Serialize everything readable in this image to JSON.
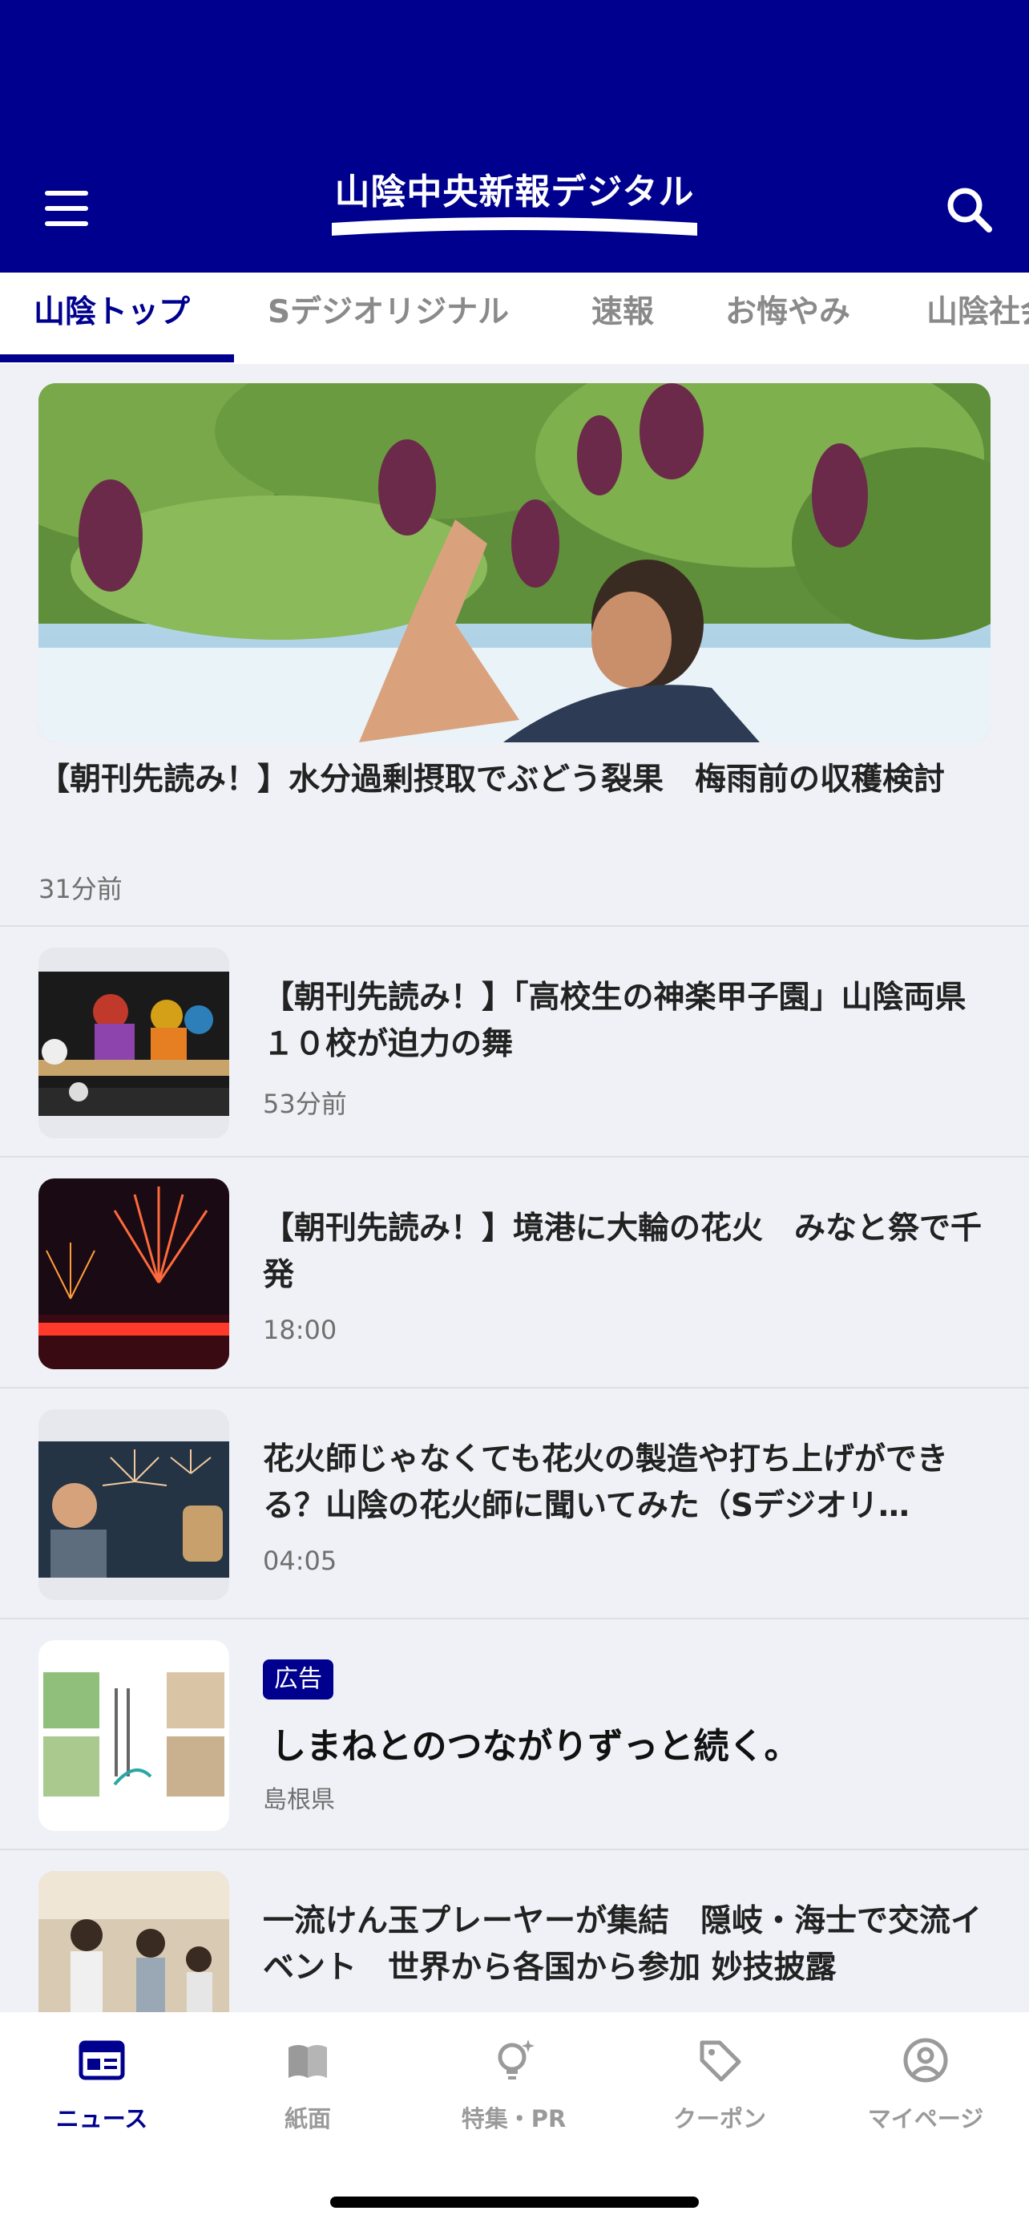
{
  "header": {
    "logo_text": "山陰中央新報デジタル",
    "brand_color": "#00008f"
  },
  "tabs": [
    {
      "label": "山陰トップ",
      "active": true
    },
    {
      "label": "Sデジオリジナル"
    },
    {
      "label": "速報"
    },
    {
      "label": "お悔やみ"
    },
    {
      "label": "山陰社会"
    }
  ],
  "hero": {
    "title": "【朝刊先読み！】水分過剰摂取でぶどう裂果　梅雨前の収穫検討",
    "time": "31分前"
  },
  "articles": [
    {
      "title": "【朝刊先読み！】「高校生の神楽甲子園」山陰両県１０校が迫力の舞",
      "time": "53分前"
    },
    {
      "title": "【朝刊先読み！】境港に大輪の花火　みなと祭で千発",
      "time": "18:00"
    },
    {
      "title": "花火師じゃなくても花火の製造や打ち上げができる？山陰の花火師に聞いてみた（Sデジオリ…",
      "time": "04:05"
    },
    {
      "title": "一流けん玉プレーヤーが集結　隠岐・海士で交流イベント　世界から各国から参加 妙技披露",
      "time": ""
    }
  ],
  "ad": {
    "badge": "広告",
    "title": "しまねとのつながりずっと続く。",
    "sponsor": "島根県"
  },
  "bottom_nav": [
    {
      "label": "ニュース",
      "icon": "news-icon",
      "active": true
    },
    {
      "label": "紙面",
      "icon": "book-icon"
    },
    {
      "label": "特集・PR",
      "icon": "lightbulb-icon"
    },
    {
      "label": "クーポン",
      "icon": "tag-icon"
    },
    {
      "label": "マイページ",
      "icon": "user-icon"
    }
  ]
}
